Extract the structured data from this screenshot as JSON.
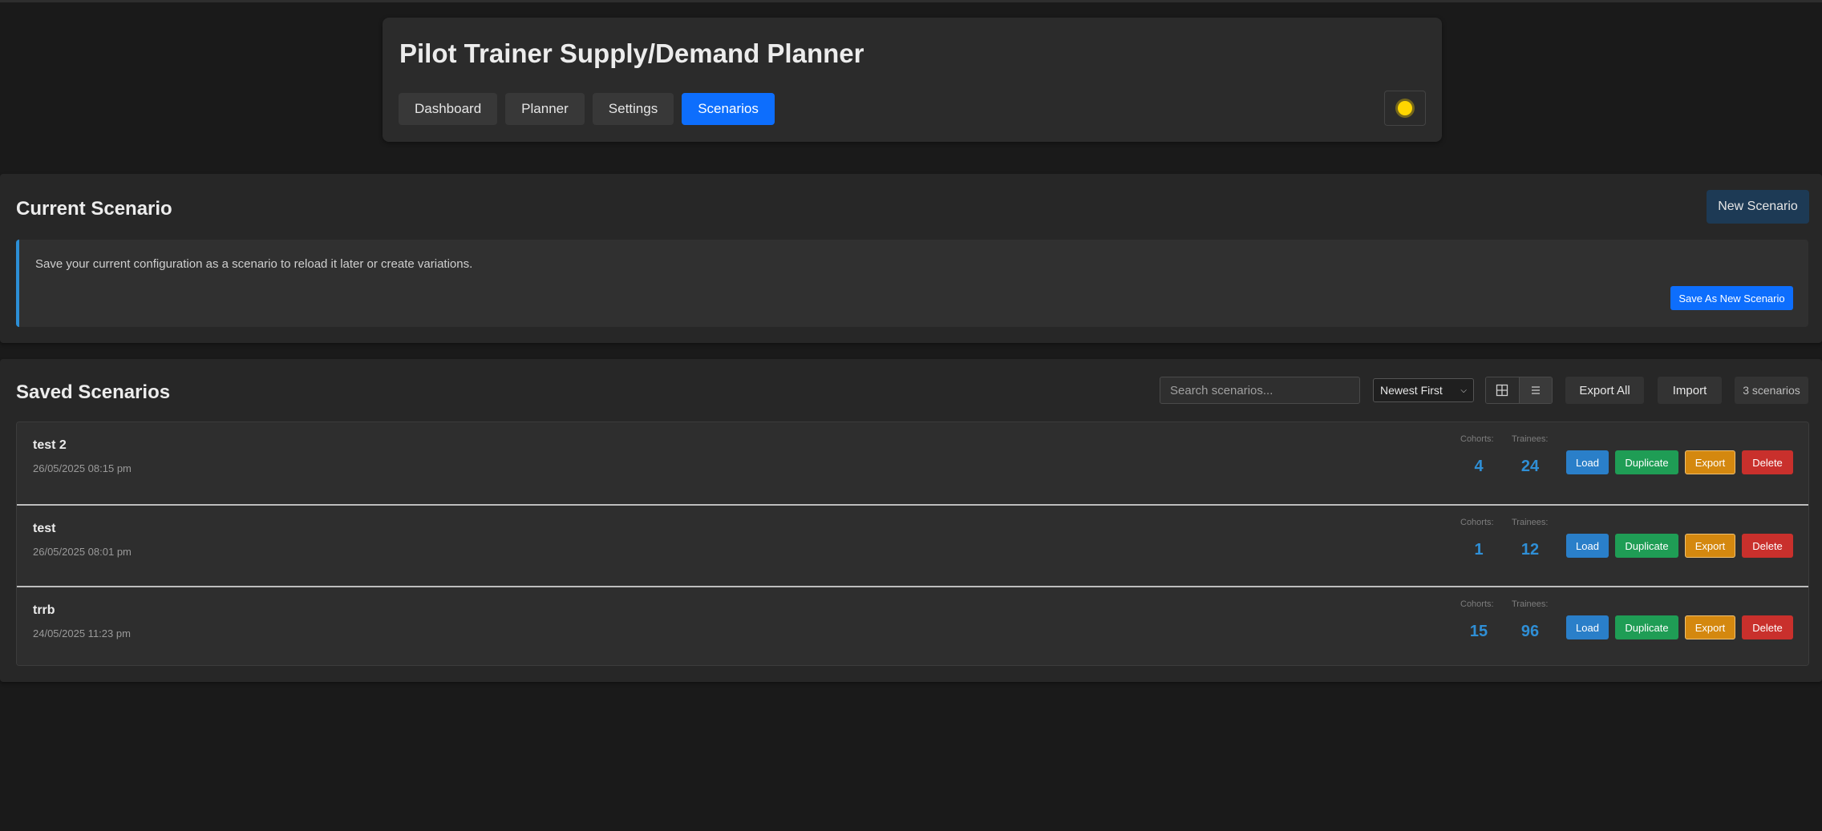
{
  "app": {
    "title": "Pilot Trainer Supply/Demand Planner"
  },
  "nav": {
    "items": [
      {
        "label": "Dashboard",
        "active": false
      },
      {
        "label": "Planner",
        "active": false
      },
      {
        "label": "Settings",
        "active": false
      },
      {
        "label": "Scenarios",
        "active": true
      }
    ],
    "theme_icon": "sun-icon"
  },
  "current": {
    "title": "Current Scenario",
    "new_button": "New Scenario",
    "info": "Save your current configuration as a scenario to reload it later or create variations.",
    "save_button": "Save As New Scenario"
  },
  "saved": {
    "title": "Saved Scenarios",
    "search_placeholder": "Search scenarios...",
    "sort_value": "Newest First",
    "export_all": "Export All",
    "import": "Import",
    "count": "3 scenarios",
    "stat_labels": {
      "cohorts": "Cohorts:",
      "trainees": "Trainees:"
    },
    "actions": {
      "load": "Load",
      "duplicate": "Duplicate",
      "export": "Export",
      "delete": "Delete"
    },
    "items": [
      {
        "name": "test 2",
        "date": "26/05/2025 08:15 pm",
        "cohorts": "4",
        "trainees": "24"
      },
      {
        "name": "test",
        "date": "26/05/2025 08:01 pm",
        "cohorts": "1",
        "trainees": "12"
      },
      {
        "name": "trrb",
        "date": "24/05/2025 11:23 pm",
        "cohorts": "15",
        "trainees": "96"
      }
    ]
  },
  "colors": {
    "accent": "#0d6efd",
    "load": "#2a7fc9",
    "duplicate": "#1f9d55",
    "export": "#d4880f",
    "delete": "#c9302c",
    "stat_value": "#2f8fd6"
  }
}
